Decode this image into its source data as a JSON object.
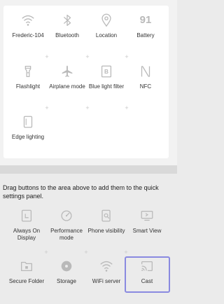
{
  "active_tiles": [
    {
      "label": "Frederic-104",
      "icon": "wifi-icon"
    },
    {
      "label": "Bluetooth",
      "icon": "bluetooth-icon"
    },
    {
      "label": "Location",
      "icon": "location-icon"
    },
    {
      "label": "Battery",
      "icon": "battery-icon",
      "value": "91"
    },
    {
      "label": "Flashlight",
      "icon": "flashlight-icon"
    },
    {
      "label": "Airplane mode",
      "icon": "airplane-icon"
    },
    {
      "label": "Blue light filter",
      "icon": "blue-light-filter-icon",
      "badge": "B"
    },
    {
      "label": "NFC",
      "icon": "nfc-icon"
    },
    {
      "label": "Edge lighting",
      "icon": "edge-lighting-icon"
    }
  ],
  "instructions": "Drag buttons to the area above to add them to the quick settings panel.",
  "available_tiles": [
    {
      "label": "Always On Display",
      "icon": "always-on-display-icon"
    },
    {
      "label": "Performance mode",
      "icon": "performance-mode-icon"
    },
    {
      "label": "Phone visibility",
      "icon": "phone-visibility-icon"
    },
    {
      "label": "Smart View",
      "icon": "smart-view-icon"
    },
    {
      "label": "Secure Folder",
      "icon": "secure-folder-icon"
    },
    {
      "label": "Storage",
      "icon": "storage-icon"
    },
    {
      "label": "WiFi server",
      "icon": "wifi-server-icon"
    },
    {
      "label": "Cast",
      "icon": "cast-icon",
      "highlighted": true
    }
  ],
  "colors": {
    "icon": "#b9b9b9",
    "highlight": "#8a8ae0"
  }
}
